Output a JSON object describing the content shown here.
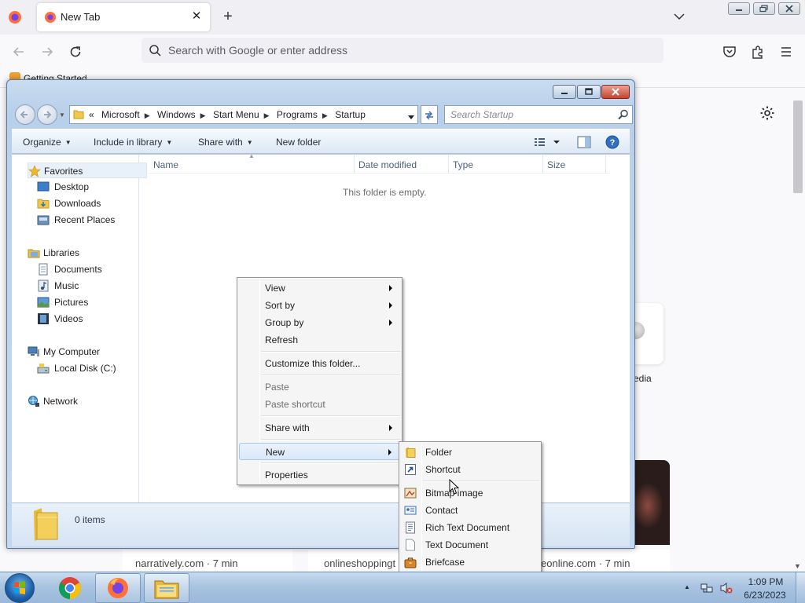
{
  "firefox": {
    "tab_title": "New Tab",
    "tab_close": "✕",
    "new_tab": "+",
    "url_placeholder": "Search with Google or enter address",
    "bookmark": "Getting Started",
    "tile_label": "edia",
    "stories": [
      "narratively.com · 7 min",
      "onlineshoppingt",
      "eonline.com · 7 min"
    ]
  },
  "explorer": {
    "breadcrumb": [
      "Microsoft",
      "Windows",
      "Start Menu",
      "Programs",
      "Startup"
    ],
    "breadcrumb_prefix": "«",
    "search_placeholder": "Search Startup",
    "toolbar": {
      "organize": "Organize",
      "include_in_library": "Include in library",
      "share_with": "Share with",
      "new_folder": "New folder"
    },
    "nav": {
      "favorites": "Favorites",
      "desktop": "Desktop",
      "downloads": "Downloads",
      "recent_places": "Recent Places",
      "libraries": "Libraries",
      "documents": "Documents",
      "music": "Music",
      "pictures": "Pictures",
      "videos": "Videos",
      "my_computer": "My Computer",
      "local_disk": "Local Disk (C:)",
      "network": "Network"
    },
    "columns": [
      "Name",
      "Date modified",
      "Type",
      "Size"
    ],
    "empty_message": "This folder is empty.",
    "item_count": "0 items"
  },
  "context_menu": {
    "items": [
      "View",
      "Sort by",
      "Group by",
      "Refresh",
      "Customize this folder...",
      "Paste",
      "Paste shortcut",
      "Share with",
      "New",
      "Properties"
    ]
  },
  "new_submenu": {
    "items": [
      "Folder",
      "Shortcut",
      "Bitmap image",
      "Contact",
      "Rich Text Document",
      "Text Document",
      "Briefcase"
    ]
  },
  "taskbar": {
    "time": "1:09 PM",
    "date": "6/23/2023"
  }
}
